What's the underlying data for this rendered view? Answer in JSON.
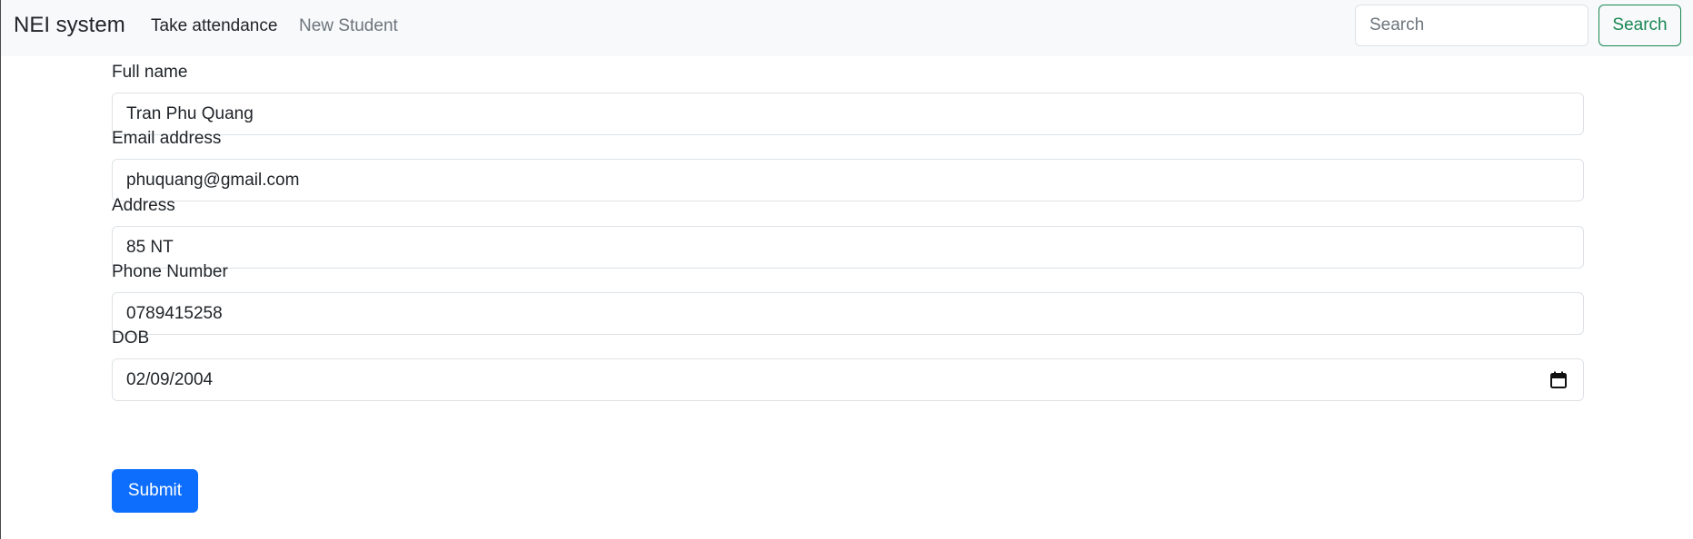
{
  "navbar": {
    "brand": "NEI system",
    "links": [
      {
        "label": "Take attendance",
        "active": true
      },
      {
        "label": "New Student",
        "active": false
      }
    ],
    "search_placeholder": "Search",
    "search_button": "Search"
  },
  "form": {
    "full_name": {
      "label": "Full name",
      "value": "Tran Phu Quang"
    },
    "email": {
      "label": "Email address",
      "value": "phuquang@gmail.com"
    },
    "address": {
      "label": "Address",
      "value": "85 NT"
    },
    "phone": {
      "label": "Phone Number",
      "value": "0789415258"
    },
    "dob": {
      "label": "DOB",
      "value": "02/09/2004"
    },
    "submit_label": "Submit"
  },
  "colors": {
    "navbar_bg": "#f8f9fa",
    "primary": "#0d6efd",
    "success": "#198754",
    "muted_link": "#6c757d"
  }
}
